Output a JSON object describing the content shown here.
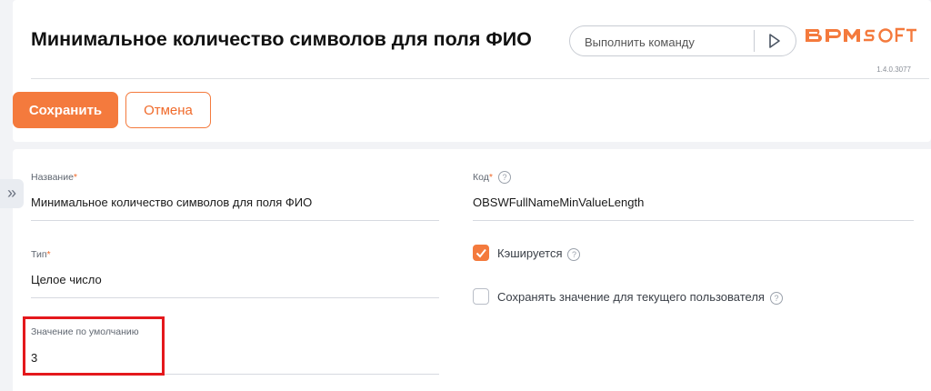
{
  "header": {
    "title": "Минимальное количество символов для поля ФИО",
    "command_placeholder": "Выполнить команду",
    "version": "1.4.0.3077",
    "logo_text": "BPMSOFT",
    "accent_color": "#f47a3d"
  },
  "toolbar": {
    "save_label": "Сохранить",
    "cancel_label": "Отмена"
  },
  "sidebar_toggle": {
    "icon": "double-chevron-right-icon",
    "glyph": "»"
  },
  "form": {
    "name": {
      "label": "Название",
      "required": "*",
      "value": "Минимальное количество символов для поля ФИО"
    },
    "code": {
      "label": "Код",
      "required": "*",
      "value": "OBSWFullNameMinValueLength",
      "help": "?"
    },
    "type": {
      "label": "Тип",
      "required": "*",
      "value": "Целое число"
    },
    "cached": {
      "label": "Кэшируется",
      "checked": true,
      "help": "?",
      "check_glyph": "✓"
    },
    "save_for_user": {
      "label": "Сохранять значение для текущего пользователя",
      "checked": false,
      "help": "?"
    },
    "default_value": {
      "label": "Значение по умолчанию",
      "value": "3"
    }
  }
}
